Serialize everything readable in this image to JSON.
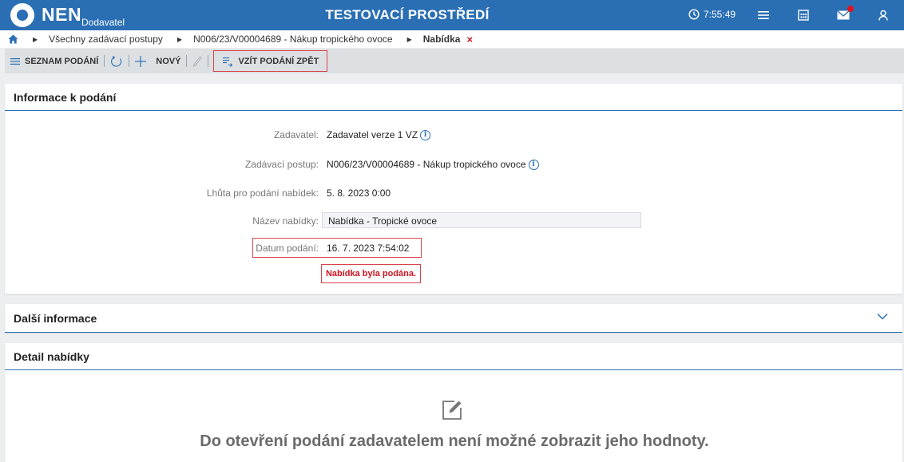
{
  "header": {
    "logo_text": "NEN",
    "logo_sub": "Dodavatel",
    "env_title": "TESTOVACÍ PROSTŘEDÍ",
    "time": "7:55:49",
    "icons": [
      "clock-icon",
      "menu-icon",
      "calculator-icon",
      "mail-icon",
      "user-icon"
    ]
  },
  "breadcrumb": {
    "items": [
      "Všechny zadávací postupy",
      "N006/23/V00004689 - Nákup tropického ovoce",
      "Nabídka"
    ],
    "close": "×"
  },
  "toolbar": {
    "list_label": "SEZNAM PODÁNÍ",
    "new_label": "NOVÝ",
    "withdraw_label": "VZÍT PODÁNÍ ZPĚT"
  },
  "info_section": {
    "title": "Informace k podání",
    "fields": [
      {
        "label": "Zadavatel:",
        "value": "Zadavatel verze 1 VZ"
      },
      {
        "label": "Zadávací postup:",
        "value": "N006/23/V00004689 - Nákup tropického ovoce"
      },
      {
        "label": "Lhůta pro podání nabídek:",
        "value": "5. 8. 2023 0:00"
      },
      {
        "label": "Název nabídky:",
        "value": "Nabídka - Tropické ovoce"
      },
      {
        "label": "Datum podání:",
        "value": "16. 7. 2023 7:54:02"
      }
    ],
    "status_message": "Nabídka byla podána."
  },
  "more_section": {
    "title": "Další informace"
  },
  "detail_section": {
    "title": "Detail nabídky",
    "empty_message": "Do otevření podání zadavatelem není možné zobrazit jeho hodnoty."
  },
  "colors": {
    "primary": "#2a6fb4",
    "highlight_red": "#d9434a",
    "error_text": "#d0141e"
  }
}
